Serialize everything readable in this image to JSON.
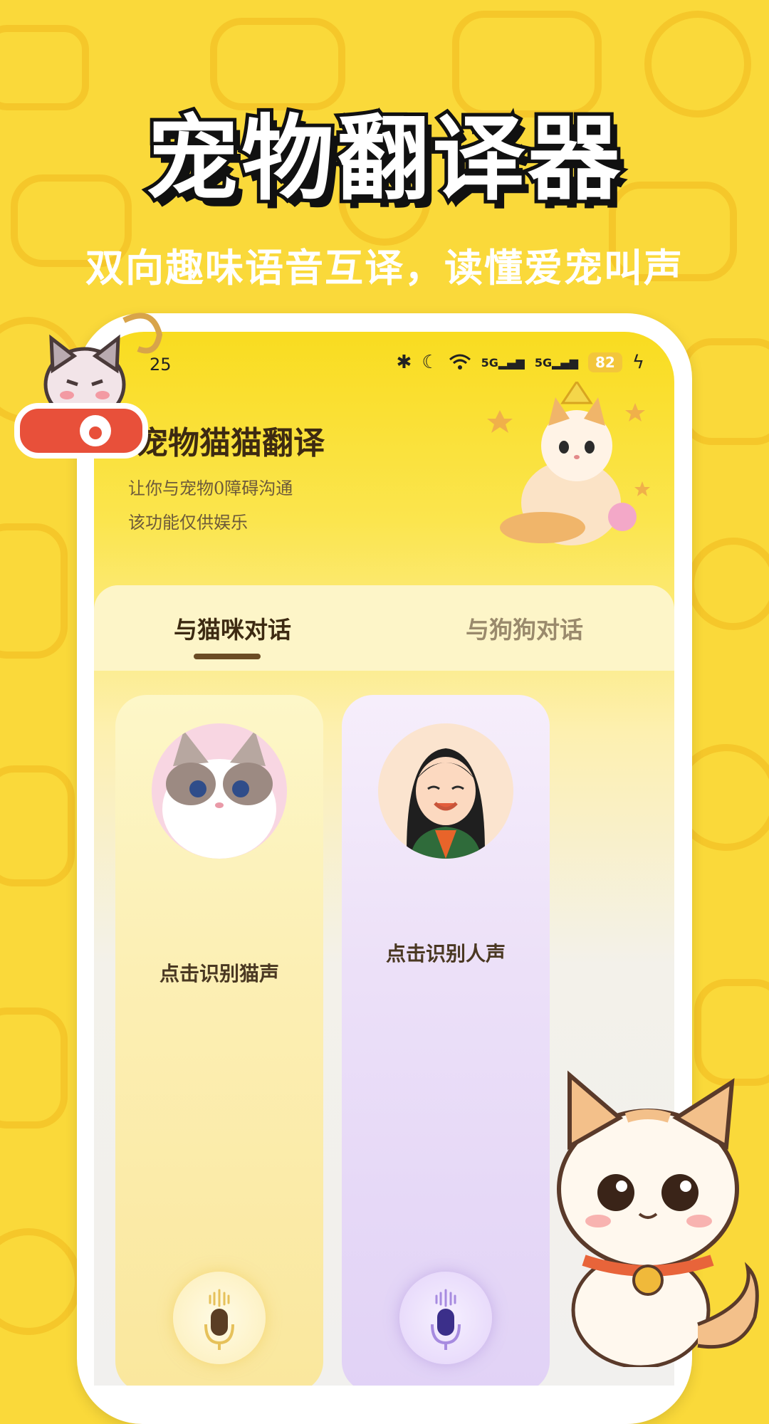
{
  "promo": {
    "headline": "宠物翻译器",
    "subline": "双向趣味语音互译，读懂爱宠叫声"
  },
  "status_bar": {
    "time": "25",
    "icons": [
      "bluetooth-icon",
      "moon-icon",
      "wifi-icon",
      "5g-signal-icon",
      "5g-signal-icon"
    ],
    "battery": "82",
    "net_label_1": "5G",
    "net_label_2": "5G"
  },
  "header": {
    "title": "宠物猫猫翻译",
    "subtitle_1": "让你与宠物0障碍沟通",
    "subtitle_2": "该功能仅供娱乐"
  },
  "tabs": [
    {
      "label": "与猫咪对话",
      "active": true
    },
    {
      "label": "与狗狗对话",
      "active": false
    }
  ],
  "cards": {
    "cat": {
      "label": "点击识别猫声",
      "icon": "microphone-icon"
    },
    "human": {
      "label": "点击识别人声",
      "icon": "microphone-icon"
    }
  },
  "colors": {
    "background": "#fad93a",
    "accent_brown": "#6b4c24",
    "cat_card": "#fcefb4",
    "human_card": "#ece0f8"
  }
}
